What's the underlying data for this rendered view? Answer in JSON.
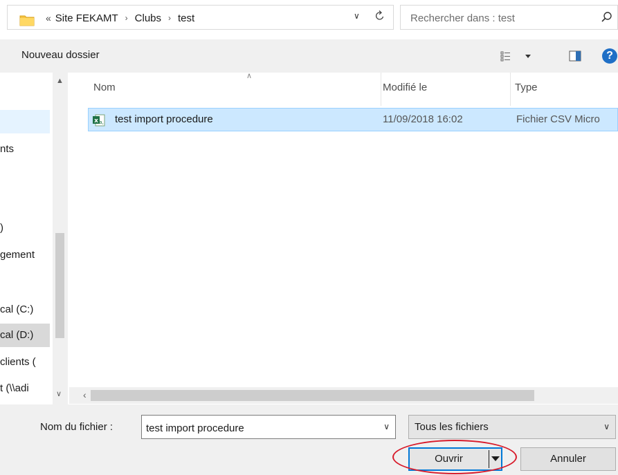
{
  "address_bar": {
    "lead": "«",
    "crumbs": [
      "Site FEKAMT",
      "Clubs",
      "test"
    ],
    "separator": "›"
  },
  "search": {
    "placeholder": "Rechercher dans : test"
  },
  "toolbar": {
    "new_folder": "Nouveau dossier",
    "help": "?"
  },
  "nav": {
    "items": [
      {
        "label": ""
      },
      {
        "label": "nts"
      },
      {
        "label": ")"
      },
      {
        "label": "gement"
      },
      {
        "label": "cal (C:)"
      },
      {
        "label": "cal (D:)"
      },
      {
        "label": "clients ("
      },
      {
        "label": "t (\\\\adi"
      }
    ]
  },
  "file_list": {
    "columns": {
      "name": "Nom",
      "modified": "Modifié le",
      "type": "Type"
    },
    "rows": [
      {
        "name": "test import procedure",
        "modified": "11/09/2018 16:02",
        "type": "Fichier CSV Micro"
      }
    ]
  },
  "bottom": {
    "filename_label": "Nom du fichier :",
    "filename_value": "test import procedure",
    "filter": "Tous les fichiers",
    "open": "Ouvrir",
    "cancel": "Annuler"
  },
  "colors": {
    "accent": "#0078d7",
    "selection": "#cce8ff",
    "annotation": "#d81b2b"
  }
}
